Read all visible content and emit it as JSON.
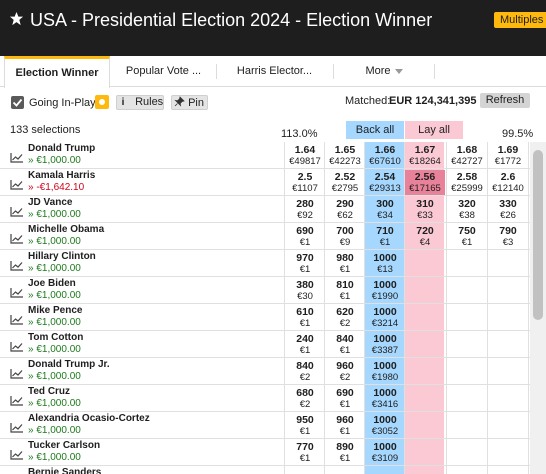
{
  "header": {
    "title": "USA - Presidential Election 2024 - Election Winner",
    "badge": "Multiples",
    "star_icon": "star-icon"
  },
  "tabs": [
    {
      "label": "Election Winner",
      "active": true
    },
    {
      "label": "Popular Vote ...",
      "active": false
    },
    {
      "label": "Harris Elector...",
      "active": false
    },
    {
      "label": "More",
      "active": false
    }
  ],
  "toolbar": {
    "going_inplay": "Going In-Play",
    "rules": "Rules",
    "pin": "Pin",
    "matched_label": "Matched:",
    "matched_value": "EUR 124,341,395",
    "refresh": "Refresh"
  },
  "summary": {
    "selections": "133 selections",
    "back_pct": "113.0%",
    "back_all": "Back all",
    "lay_all": "Lay all",
    "lay_pct": "99.5%"
  },
  "colors": {
    "back": "#a6d8ff",
    "lay": "#fac9d4",
    "brand": "#ffb80c",
    "header_bg": "#1e1e1e"
  },
  "runners": [
    {
      "name": "Donald Trump",
      "pl": "» €1,000.00",
      "neg": false,
      "cells": [
        [
          "1.64",
          "€49817"
        ],
        [
          "1.65",
          "€42273"
        ],
        [
          "1.66",
          "€67610"
        ],
        [
          "1.67",
          "€18264"
        ],
        [
          "1.68",
          "€42727"
        ],
        [
          "1.69",
          "€1772"
        ]
      ]
    },
    {
      "name": "Kamala Harris",
      "pl": "» -€1,642.10",
      "neg": true,
      "cells": [
        [
          "2.5",
          "€1107"
        ],
        [
          "2.52",
          "€2795"
        ],
        [
          "2.54",
          "€29313"
        ],
        [
          "2.56",
          "€17165"
        ],
        [
          "2.58",
          "€25999"
        ],
        [
          "2.6",
          "€12140"
        ]
      ]
    },
    {
      "name": "JD Vance",
      "pl": "» €1,000.00",
      "neg": false,
      "cells": [
        [
          "280",
          "€92"
        ],
        [
          "290",
          "€62"
        ],
        [
          "300",
          "€34"
        ],
        [
          "310",
          "€33"
        ],
        [
          "320",
          "€38"
        ],
        [
          "330",
          "€26"
        ]
      ]
    },
    {
      "name": "Michelle Obama",
      "pl": "» €1,000.00",
      "neg": false,
      "cells": [
        [
          "690",
          "€1"
        ],
        [
          "700",
          "€9"
        ],
        [
          "710",
          "€1"
        ],
        [
          "720",
          "€4"
        ],
        [
          "750",
          "€1"
        ],
        [
          "790",
          "€3"
        ]
      ]
    },
    {
      "name": "Hillary Clinton",
      "pl": "» €1,000.00",
      "neg": false,
      "cells": [
        [
          "970",
          "€1"
        ],
        [
          "980",
          "€1"
        ],
        [
          "1000",
          "€13"
        ],
        [
          "",
          ""
        ],
        [
          "",
          ""
        ],
        [
          "",
          ""
        ]
      ]
    },
    {
      "name": "Joe Biden",
      "pl": "» €1,000.00",
      "neg": false,
      "cells": [
        [
          "380",
          "€30"
        ],
        [
          "810",
          "€1"
        ],
        [
          "1000",
          "€1990"
        ],
        [
          "",
          ""
        ],
        [
          "",
          ""
        ],
        [
          "",
          ""
        ]
      ]
    },
    {
      "name": "Mike Pence",
      "pl": "» €1,000.00",
      "neg": false,
      "cells": [
        [
          "610",
          "€1"
        ],
        [
          "620",
          "€2"
        ],
        [
          "1000",
          "€3214"
        ],
        [
          "",
          ""
        ],
        [
          "",
          ""
        ],
        [
          "",
          ""
        ]
      ]
    },
    {
      "name": "Tom Cotton",
      "pl": "» €1,000.00",
      "neg": false,
      "cells": [
        [
          "240",
          "€1"
        ],
        [
          "840",
          "€1"
        ],
        [
          "1000",
          "€3387"
        ],
        [
          "",
          ""
        ],
        [
          "",
          ""
        ],
        [
          "",
          ""
        ]
      ]
    },
    {
      "name": "Donald Trump Jr.",
      "pl": "» €1,000.00",
      "neg": false,
      "cells": [
        [
          "840",
          "€2"
        ],
        [
          "960",
          "€2"
        ],
        [
          "1000",
          "€1980"
        ],
        [
          "",
          ""
        ],
        [
          "",
          ""
        ],
        [
          "",
          ""
        ]
      ]
    },
    {
      "name": "Ted Cruz",
      "pl": "» €1,000.00",
      "neg": false,
      "cells": [
        [
          "680",
          "€2"
        ],
        [
          "690",
          "€1"
        ],
        [
          "1000",
          "€3416"
        ],
        [
          "",
          ""
        ],
        [
          "",
          ""
        ],
        [
          "",
          ""
        ]
      ]
    },
    {
      "name": "Alexandria Ocasio-Cortez",
      "pl": "» €1,000.00",
      "neg": false,
      "cells": [
        [
          "950",
          "€1"
        ],
        [
          "960",
          "€1"
        ],
        [
          "1000",
          "€3052"
        ],
        [
          "",
          ""
        ],
        [
          "",
          ""
        ],
        [
          "",
          ""
        ]
      ]
    },
    {
      "name": "Tucker Carlson",
      "pl": "» €1,000.00",
      "neg": false,
      "cells": [
        [
          "770",
          "€1"
        ],
        [
          "890",
          "€1"
        ],
        [
          "1000",
          "€3109"
        ],
        [
          "",
          ""
        ],
        [
          "",
          ""
        ],
        [
          "",
          ""
        ]
      ]
    },
    {
      "name": "Bernie Sanders",
      "pl": "",
      "neg": false,
      "cells": [
        [
          "",
          ""
        ],
        [
          "",
          ""
        ],
        [
          "",
          ""
        ],
        [
          "",
          ""
        ],
        [
          "",
          ""
        ],
        [
          "",
          ""
        ]
      ]
    }
  ]
}
